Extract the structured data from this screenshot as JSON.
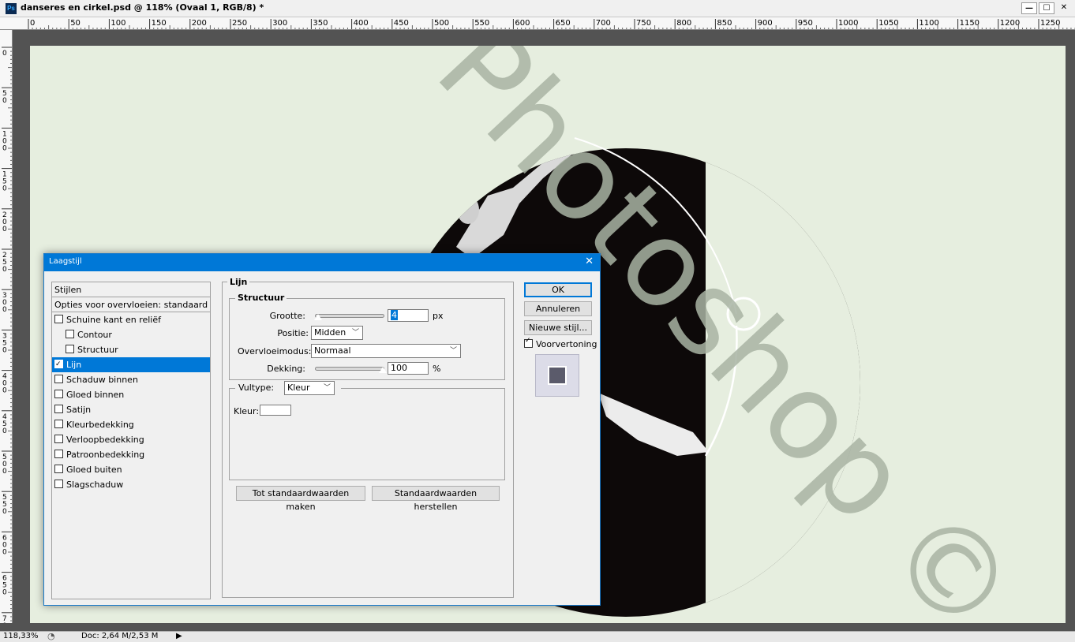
{
  "window": {
    "app_icon": "Ps",
    "title": "danseres en cirkel.psd @ 118% (Ovaal 1, RGB/8) *",
    "controls": [
      "—",
      "☐",
      "✕"
    ]
  },
  "ruler": {
    "h_labels": [
      "0",
      "50",
      "100",
      "150",
      "200",
      "250",
      "300",
      "350",
      "400",
      "450",
      "500",
      "550",
      "600",
      "650",
      "700",
      "750",
      "800",
      "850",
      "900",
      "950",
      "1000",
      "1050",
      "1100",
      "1150",
      "1200",
      "1250"
    ],
    "v_labels": [
      "0",
      "50",
      "100",
      "150",
      "200",
      "250",
      "300",
      "350",
      "400",
      "450",
      "500",
      "550",
      "600",
      "650",
      "700"
    ]
  },
  "watermark": "Photoshop ©",
  "dialog": {
    "title": "Laagstijl",
    "close": "✕",
    "styles": {
      "header": "Stijlen",
      "blend_options": "Opties voor overvloeien: standaard",
      "items": [
        {
          "label": "Schuine kant en reliëf",
          "checked": false,
          "indent": false
        },
        {
          "label": "Contour",
          "checked": false,
          "indent": true
        },
        {
          "label": "Structuur",
          "checked": false,
          "indent": true
        },
        {
          "label": "Lijn",
          "checked": true,
          "indent": false
        },
        {
          "label": "Schaduw binnen",
          "checked": false,
          "indent": false
        },
        {
          "label": "Gloed binnen",
          "checked": false,
          "indent": false
        },
        {
          "label": "Satijn",
          "checked": false,
          "indent": false
        },
        {
          "label": "Kleurbedekking",
          "checked": false,
          "indent": false
        },
        {
          "label": "Verloopbedekking",
          "checked": false,
          "indent": false
        },
        {
          "label": "Patroonbedekking",
          "checked": false,
          "indent": false
        },
        {
          "label": "Gloed buiten",
          "checked": false,
          "indent": false
        },
        {
          "label": "Slagschaduw",
          "checked": false,
          "indent": false
        }
      ]
    },
    "stroke": {
      "group_title": "Lijn",
      "structure_title": "Structuur",
      "size_label": "Grootte:",
      "size_value": "4",
      "size_unit": "px",
      "position_label": "Positie:",
      "position_value": "Midden",
      "blend_label": "Overvloeimodus:",
      "blend_value": "Normaal",
      "opacity_label": "Dekking:",
      "opacity_value": "100",
      "opacity_unit": "%",
      "fill_type_label": "Vultype:",
      "fill_type_value": "Kleur",
      "color_label": "Kleur:",
      "color_swatch": "#ffffff",
      "make_default": "Tot standaardwaarden maken",
      "reset_default": "Standaardwaarden herstellen"
    },
    "buttons": {
      "ok": "OK",
      "cancel": "Annuleren",
      "new_style": "Nieuwe stijl...",
      "preview_label": "Voorvertoning",
      "preview_checked": true
    }
  },
  "status": {
    "zoom": "118,33%",
    "doc": "Doc: 2,64 M/2,53 M",
    "arrow": "▶"
  },
  "colors": {
    "canvas_bg": "#e6eedf",
    "accent": "#0078d7",
    "watermark": "#a9b4a4"
  }
}
